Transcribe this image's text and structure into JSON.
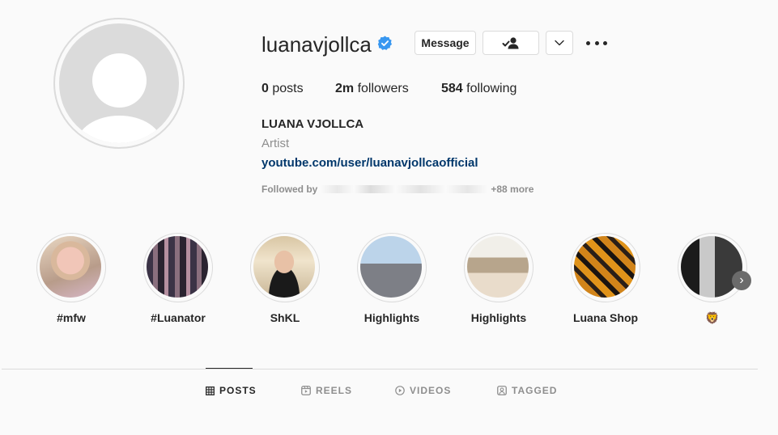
{
  "profile": {
    "username": "luanavjollca",
    "verified": true,
    "full_name": "LUANA VJOLLCA",
    "category": "Artist",
    "website": "youtube.com/user/luanavjollcaofficial",
    "followed_by_prefix": "Followed by",
    "followed_by_more": "+88 more"
  },
  "actions": {
    "message_label": "Message"
  },
  "stats": {
    "posts_value": "0",
    "posts_label": " posts",
    "followers_value": "2m",
    "followers_label": " followers",
    "following_value": "584",
    "following_label": " following"
  },
  "highlights": [
    {
      "label": "#mfw"
    },
    {
      "label": "#Luanator"
    },
    {
      "label": "ShKL"
    },
    {
      "label": "Highlights"
    },
    {
      "label": "Highlights"
    },
    {
      "label": "Luana Shop"
    },
    {
      "label": "🦁"
    }
  ],
  "tabs": [
    {
      "label": "POSTS",
      "icon": "grid-icon",
      "active": true
    },
    {
      "label": "REELS",
      "icon": "reels-icon",
      "active": false
    },
    {
      "label": "VIDEOS",
      "icon": "play-icon",
      "active": false
    },
    {
      "label": "TAGGED",
      "icon": "tag-icon",
      "active": false
    }
  ],
  "colors": {
    "verified": "#3897f0",
    "link": "#00376b",
    "secondary_text": "#8e8e8e"
  }
}
